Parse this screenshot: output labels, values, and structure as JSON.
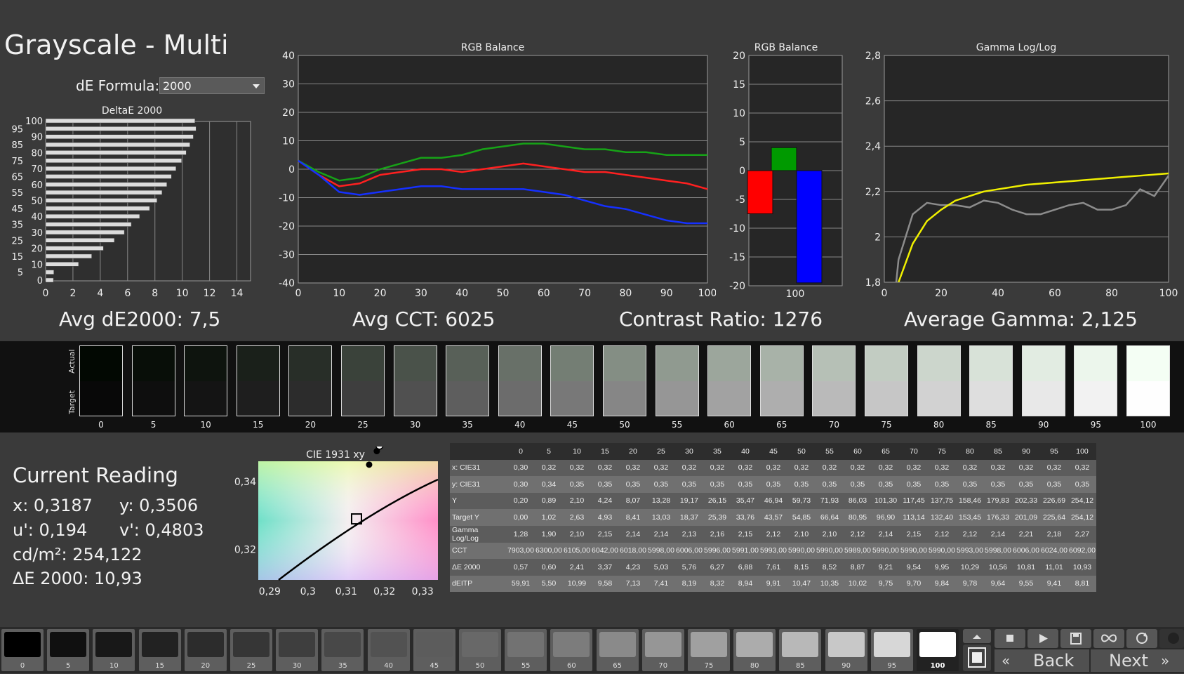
{
  "header": {
    "title": "Grayscale - Multi",
    "formula_label": "dE Formula:",
    "formula_value": "2000"
  },
  "deltae_chart": {
    "title": "DeltaE 2000",
    "y_ticks": [
      "100",
      "95",
      "90",
      "85",
      "80",
      "75",
      "70",
      "65",
      "60",
      "55",
      "50",
      "45",
      "40",
      "35",
      "30",
      "25",
      "20",
      "15",
      "10",
      "5",
      "0"
    ],
    "x_ticks": [
      "0",
      "2",
      "4",
      "6",
      "8",
      "10",
      "12",
      "14"
    ]
  },
  "rgb_line_chart": {
    "title": "RGB Balance",
    "y_ticks": [
      "40",
      "30",
      "20",
      "10",
      "0",
      "-10",
      "-20",
      "-30",
      "-40"
    ],
    "x_ticks": [
      "0",
      "10",
      "20",
      "30",
      "40",
      "50",
      "60",
      "70",
      "80",
      "90",
      "100"
    ]
  },
  "rgb_bar_chart": {
    "title": "RGB Balance",
    "y_ticks": [
      "20",
      "15",
      "10",
      "5",
      "0",
      "-5",
      "-10",
      "-15",
      "-20"
    ],
    "x_tick": "100"
  },
  "gamma_chart": {
    "title": "Gamma Log/Log",
    "y_ticks": [
      "2,8",
      "2,6",
      "2,4",
      "2,2",
      "2",
      "1,8"
    ],
    "x_ticks": [
      "0",
      "20",
      "40",
      "60",
      "80",
      "100"
    ]
  },
  "stats": {
    "avg_de": "Avg dE2000: 7,5",
    "avg_cct": "Avg CCT: 6025",
    "contrast": "Contrast Ratio: 1276",
    "avg_gamma": "Average Gamma: 2,125"
  },
  "swatches": {
    "actual_label": "Actual",
    "target_label": "Target",
    "labels": [
      "0",
      "5",
      "10",
      "15",
      "20",
      "25",
      "30",
      "35",
      "40",
      "45",
      "50",
      "55",
      "60",
      "65",
      "70",
      "75",
      "80",
      "85",
      "90",
      "95",
      "100"
    ]
  },
  "current_reading": {
    "title": "Current Reading",
    "x": "x: 0,3187",
    "y": "y: 0,3506",
    "u": "u': 0,194",
    "v": "v': 0,4803",
    "cdm2": "cd/m²: 254,122",
    "de": "ΔE 2000: 10,93"
  },
  "cie_chart": {
    "title": "CIE 1931 xy",
    "y_ticks": [
      "0,34",
      "0,32"
    ],
    "x_ticks": [
      "0,29",
      "0,3",
      "0,31",
      "0,32",
      "0,33"
    ]
  },
  "table": {
    "columns": [
      "0",
      "5",
      "10",
      "15",
      "20",
      "25",
      "30",
      "35",
      "40",
      "45",
      "50",
      "55",
      "60",
      "65",
      "70",
      "75",
      "80",
      "85",
      "90",
      "95",
      "100"
    ],
    "rows": [
      {
        "label": "x: CIE31",
        "values": [
          "0,30",
          "0,32",
          "0,32",
          "0,32",
          "0,32",
          "0,32",
          "0,32",
          "0,32",
          "0,32",
          "0,32",
          "0,32",
          "0,32",
          "0,32",
          "0,32",
          "0,32",
          "0,32",
          "0,32",
          "0,32",
          "0,32",
          "0,32",
          "0,32"
        ]
      },
      {
        "label": "y: CIE31",
        "values": [
          "0,30",
          "0,34",
          "0,35",
          "0,35",
          "0,35",
          "0,35",
          "0,35",
          "0,35",
          "0,35",
          "0,35",
          "0,35",
          "0,35",
          "0,35",
          "0,35",
          "0,35",
          "0,35",
          "0,35",
          "0,35",
          "0,35",
          "0,35",
          "0,35"
        ]
      },
      {
        "label": "Y",
        "values": [
          "0,20",
          "0,89",
          "2,10",
          "4,24",
          "8,07",
          "13,28",
          "19,17",
          "26,15",
          "35,47",
          "46,94",
          "59,73",
          "71,93",
          "86,03",
          "101,30",
          "117,45",
          "137,75",
          "158,46",
          "179,83",
          "202,33",
          "226,69",
          "254,12"
        ]
      },
      {
        "label": "Target Y",
        "values": [
          "0,00",
          "1,02",
          "2,63",
          "4,93",
          "8,41",
          "13,03",
          "18,37",
          "25,39",
          "33,76",
          "43,57",
          "54,85",
          "66,64",
          "80,95",
          "96,90",
          "113,14",
          "132,40",
          "153,45",
          "176,33",
          "201,09",
          "225,64",
          "254,12"
        ]
      },
      {
        "label": "Gamma Log/Log",
        "values": [
          "1,28",
          "1,90",
          "2,10",
          "2,15",
          "2,14",
          "2,14",
          "2,13",
          "2,16",
          "2,15",
          "2,12",
          "2,10",
          "2,10",
          "2,12",
          "2,14",
          "2,15",
          "2,12",
          "2,12",
          "2,14",
          "2,21",
          "2,18",
          "2,27"
        ]
      },
      {
        "label": "CCT",
        "values": [
          "7903,00",
          "6300,00",
          "6105,00",
          "6042,00",
          "6018,00",
          "5998,00",
          "6006,00",
          "5996,00",
          "5991,00",
          "5993,00",
          "5990,00",
          "5990,00",
          "5989,00",
          "5990,00",
          "5990,00",
          "5990,00",
          "5993,00",
          "5998,00",
          "6006,00",
          "6024,00",
          "6092,00"
        ]
      },
      {
        "label": "ΔE 2000",
        "values": [
          "0,57",
          "0,60",
          "2,41",
          "3,37",
          "4,23",
          "5,03",
          "5,76",
          "6,27",
          "6,88",
          "7,61",
          "8,15",
          "8,52",
          "8,87",
          "9,21",
          "9,54",
          "9,95",
          "10,29",
          "10,56",
          "10,81",
          "11,01",
          "10,93"
        ]
      },
      {
        "label": "dEITP",
        "values": [
          "59,91",
          "5,50",
          "10,99",
          "9,58",
          "7,13",
          "7,41",
          "8,19",
          "8,32",
          "8,94",
          "9,91",
          "10,47",
          "10,35",
          "10,02",
          "9,75",
          "9,70",
          "9,84",
          "9,78",
          "9,64",
          "9,55",
          "9,41",
          "8,81"
        ]
      }
    ]
  },
  "patch_bar": {
    "labels": [
      "0",
      "5",
      "10",
      "15",
      "20",
      "25",
      "30",
      "35",
      "40",
      "45",
      "50",
      "55",
      "60",
      "65",
      "70",
      "75",
      "80",
      "85",
      "90",
      "95",
      "100"
    ],
    "selected": "100"
  },
  "nav": {
    "back": "Back",
    "next": "Next"
  },
  "chart_data": [
    {
      "type": "bar",
      "title": "DeltaE 2000",
      "orientation": "horizontal",
      "categories": [
        "0",
        "5",
        "10",
        "15",
        "20",
        "25",
        "30",
        "35",
        "40",
        "45",
        "50",
        "55",
        "60",
        "65",
        "70",
        "75",
        "80",
        "85",
        "90",
        "95",
        "100"
      ],
      "values": [
        0.57,
        0.6,
        2.41,
        3.37,
        4.23,
        5.03,
        5.76,
        6.27,
        6.88,
        7.61,
        8.15,
        8.52,
        8.87,
        9.21,
        9.54,
        9.95,
        10.29,
        10.56,
        10.81,
        11.01,
        10.93
      ],
      "xlim": [
        0,
        15
      ]
    },
    {
      "type": "line",
      "title": "RGB Balance",
      "x": [
        0,
        5,
        10,
        15,
        20,
        25,
        30,
        35,
        40,
        45,
        50,
        55,
        60,
        65,
        70,
        75,
        80,
        85,
        90,
        95,
        100
      ],
      "ylim": [
        -40,
        40
      ],
      "series": [
        {
          "color": "#ff2020",
          "values": [
            3,
            -2,
            -6,
            -5,
            -2,
            -1,
            0,
            0,
            -1,
            0,
            1,
            2,
            1,
            0,
            -1,
            -1,
            -2,
            -3,
            -4,
            -5,
            -7
          ]
        },
        {
          "color": "#17a317",
          "values": [
            3,
            -1,
            -4,
            -3,
            0,
            2,
            4,
            4,
            5,
            7,
            8,
            9,
            9,
            8,
            7,
            7,
            6,
            6,
            5,
            5,
            5
          ]
        },
        {
          "color": "#1530ff",
          "values": [
            3,
            -2,
            -8,
            -9,
            -8,
            -7,
            -6,
            -6,
            -7,
            -7,
            -7,
            -7,
            -8,
            -9,
            -11,
            -13,
            -14,
            -16,
            -18,
            -19,
            -19
          ]
        }
      ]
    },
    {
      "type": "bar",
      "title": "RGB Balance",
      "categories": [
        "R",
        "G",
        "B"
      ],
      "values": [
        -7.5,
        4,
        -19.5
      ],
      "colors": [
        "#ff0000",
        "#009a00",
        "#0000ff"
      ],
      "ylim": [
        -20,
        20
      ]
    },
    {
      "type": "line",
      "title": "Gamma Log/Log",
      "x": [
        0,
        5,
        10,
        15,
        20,
        25,
        30,
        35,
        40,
        45,
        50,
        55,
        60,
        65,
        70,
        75,
        80,
        85,
        90,
        95,
        100
      ],
      "ylim": [
        1.8,
        2.8
      ],
      "xlim": [
        0,
        100
      ],
      "series": [
        {
          "color": "#8c8c8c",
          "values": [
            1.28,
            1.9,
            2.1,
            2.15,
            2.14,
            2.14,
            2.13,
            2.16,
            2.15,
            2.12,
            2.1,
            2.1,
            2.12,
            2.14,
            2.15,
            2.12,
            2.12,
            2.14,
            2.21,
            2.18,
            2.27
          ]
        },
        {
          "color": "#f0f000",
          "values": [
            null,
            1.8,
            1.97,
            2.07,
            2.12,
            2.16,
            2.18,
            2.2,
            2.21,
            2.22,
            2.23,
            2.235,
            2.24,
            2.245,
            2.25,
            2.255,
            2.26,
            2.265,
            2.27,
            2.275,
            2.28
          ]
        }
      ]
    },
    {
      "type": "scatter",
      "title": "CIE 1931 xy",
      "xlim": [
        0.287,
        0.334
      ],
      "ylim": [
        0.311,
        0.346
      ],
      "points": [
        {
          "x": 0.3187,
          "y": 0.3506,
          "shape": "circle-open"
        },
        {
          "x": 0.318,
          "y": 0.349,
          "shape": "circle"
        },
        {
          "x": 0.316,
          "y": 0.345,
          "shape": "circle"
        },
        {
          "x": 0.3127,
          "y": 0.329,
          "shape": "target-square"
        }
      ]
    }
  ]
}
